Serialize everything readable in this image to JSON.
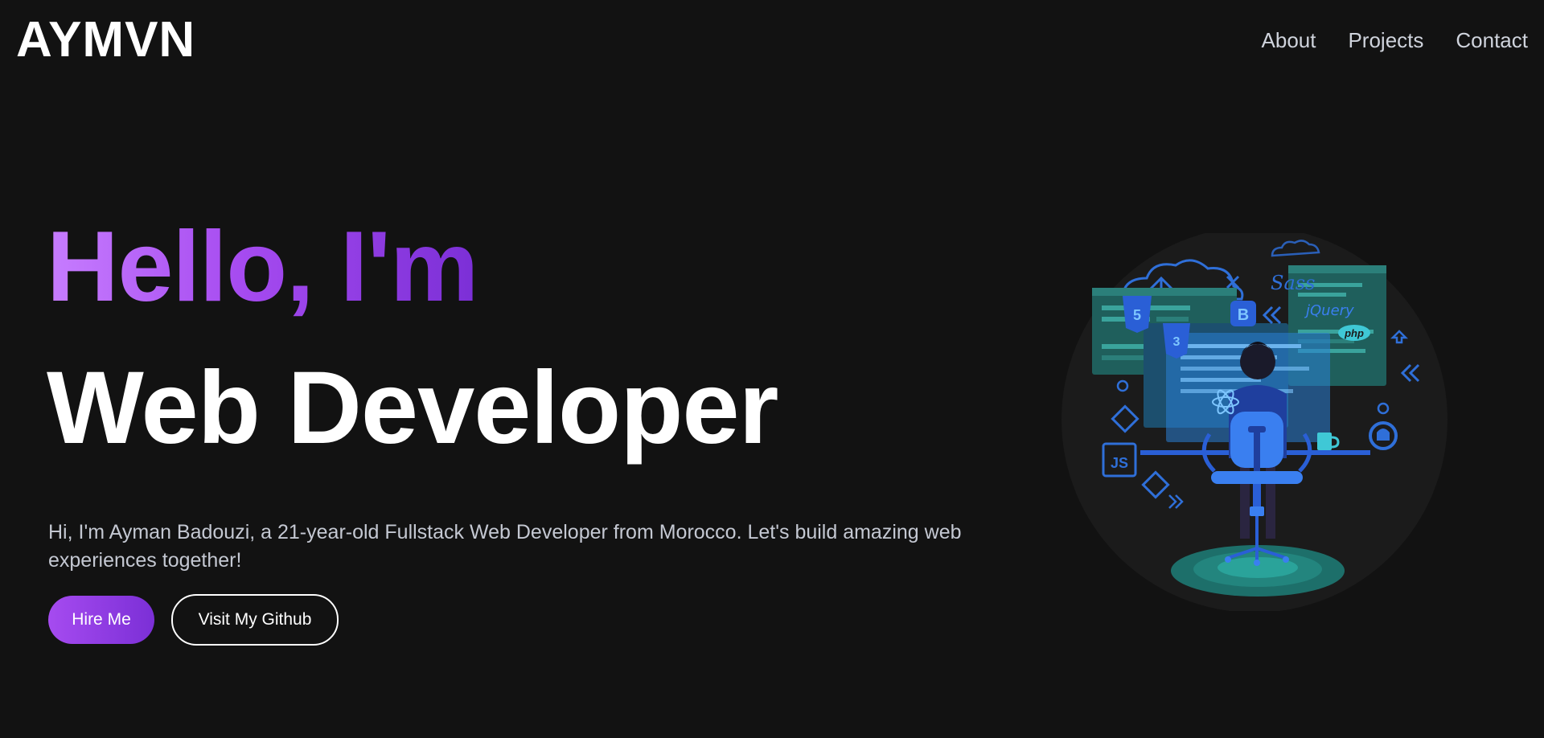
{
  "header": {
    "logo": "AYMVN",
    "nav": [
      {
        "label": "About"
      },
      {
        "label": "Projects"
      },
      {
        "label": "Contact"
      }
    ]
  },
  "hero": {
    "greeting": "Hello, I'm",
    "role": "Web Developer",
    "description": "Hi, I'm Ayman Badouzi, a 21-year-old Fullstack Web Developer from Morocco. Let's build amazing web experiences together!",
    "primary_button": "Hire Me",
    "secondary_button": "Visit My Github"
  },
  "illustration": {
    "badges": {
      "html5": "5",
      "css3": "3",
      "bootstrap": "B",
      "javascript": "JS",
      "sass": "Sass",
      "jquery": "jQuery",
      "php": "php"
    },
    "icons": [
      "cloud-icon",
      "html5-icon",
      "css3-icon",
      "bootstrap-icon",
      "sass-icon",
      "jquery-icon",
      "php-icon",
      "react-icon",
      "github-icon",
      "javascript-icon",
      "coffee-mug-icon"
    ]
  },
  "colors": {
    "background": "#121212",
    "accent_start": "#c77dff",
    "accent_end": "#7b2fd6",
    "text_muted": "#c4c8d2",
    "nav_text": "#cfd3dc"
  }
}
